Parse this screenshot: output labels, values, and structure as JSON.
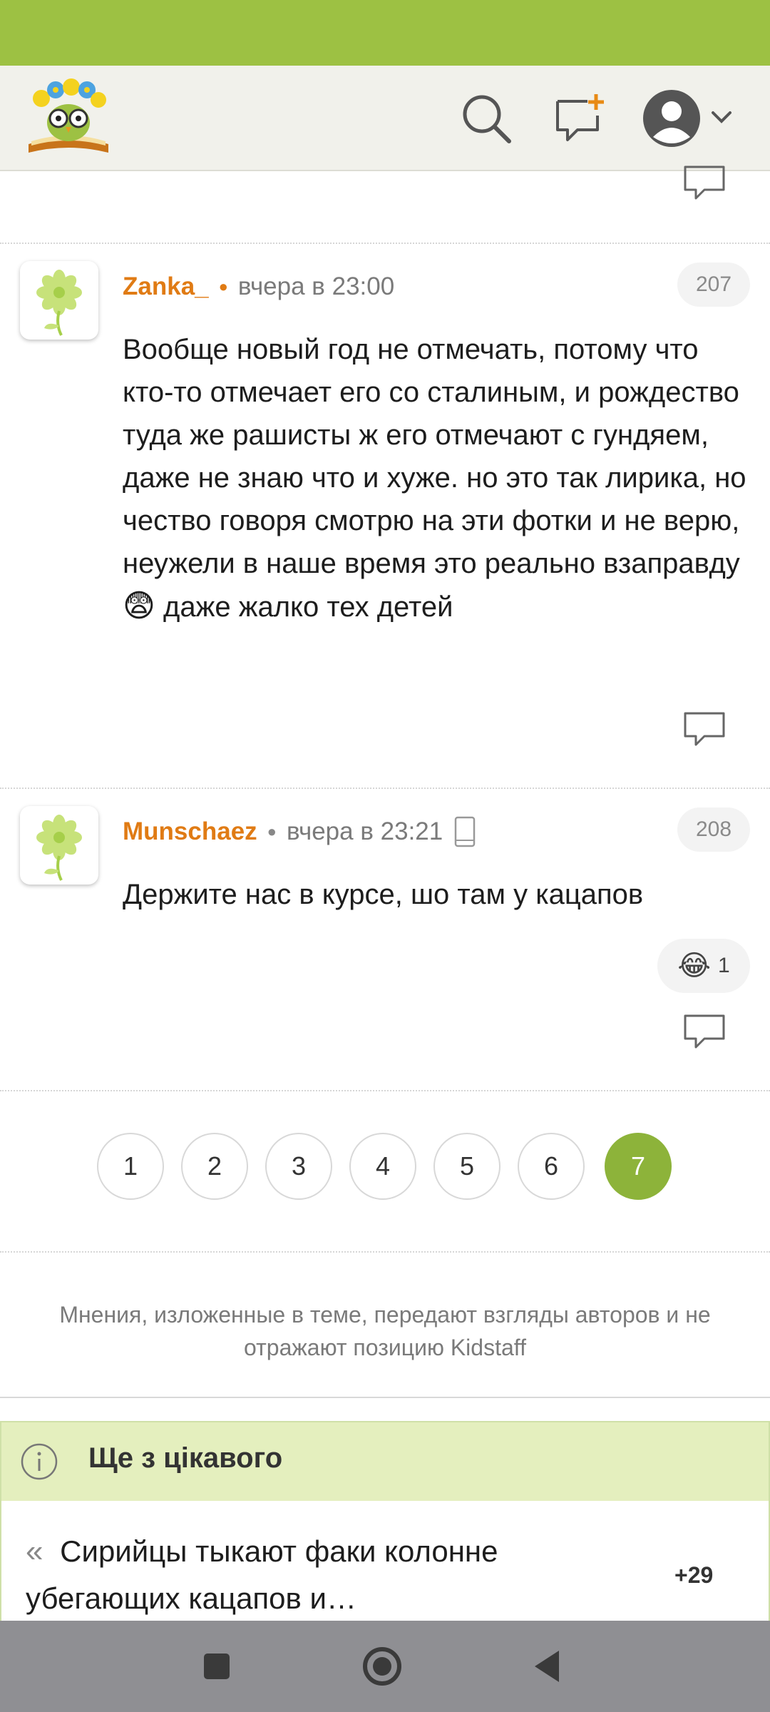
{
  "header": {
    "logo": "kidstaff-owl-logo",
    "icons": [
      "search-icon",
      "new-post-icon",
      "user-avatar-icon",
      "chevron-down-icon"
    ]
  },
  "comments": [
    {
      "author": "Zanka_",
      "time": "вчера в 23:00",
      "number": "207",
      "text": "Вообще новый год не отмечать, потому что кто-то отмечает его со сталиным, и рождество туда же рашисты ж его отмечают с гундяем, даже не знаю что и хуже. но это так лирика, но чество говоря смотрю на эти фотки и не верю, неужели в наше время это реально взаправду",
      "text_after_emoji": "даже жалко тех детей",
      "emoji": "😨"
    },
    {
      "author": "Munschaez",
      "time": "вчера в 23:21",
      "number": "208",
      "text": "Держите нас в курсе, шо там у кацапов",
      "reaction": {
        "emoji": "😂",
        "count": "1"
      }
    }
  ],
  "pagination": {
    "pages": [
      "1",
      "2",
      "3",
      "4",
      "5",
      "6",
      "7"
    ],
    "current": "7"
  },
  "disclaimer": "Мнения, изложенные в теме, передают взгляды авторов и не отражают позицию Kidstaff",
  "more": {
    "title": "Ще з цікавого",
    "item": {
      "chevron": "«",
      "text": "Сирийцы тыкают факи колонне убегающих кацапов и…",
      "score": "+29"
    }
  },
  "colors": {
    "status_bar": "#9dc143",
    "accent": "#8db33a",
    "author": "#e07b14",
    "more_header": "#e4efbe"
  }
}
